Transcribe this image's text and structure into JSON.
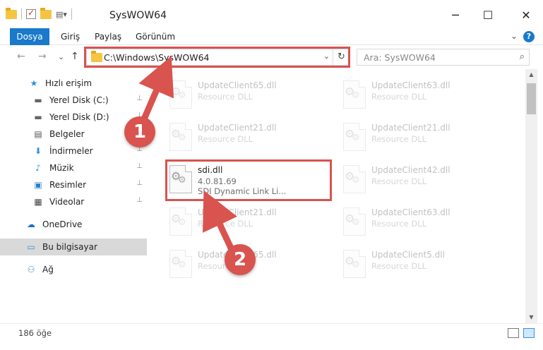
{
  "window": {
    "title": "SysWOW64",
    "minimize": "─",
    "maximize": "☐",
    "close": "✕"
  },
  "ribbon": {
    "tabs": [
      "Dosya",
      "Giriş",
      "Paylaş",
      "Görünüm"
    ],
    "expand": "⌄",
    "help": "?"
  },
  "nav": {
    "back": "←",
    "forward": "→",
    "recent": "⌄",
    "up": "↑",
    "address": "C:\\Windows\\SysWOW64",
    "address_dropdown": "⌄",
    "refresh": "↻",
    "search_placeholder": "Ara: SysWOW64",
    "search_icon": "⌕"
  },
  "sidebar": {
    "items": [
      {
        "label": "Hızlı erişim",
        "icon": "star-icon",
        "glyph": "★",
        "color": "#2f8fdc",
        "pinned": false
      },
      {
        "label": "Yerel Disk (C:)",
        "icon": "drive-icon",
        "glyph": "▬",
        "color": "#666",
        "pinned": true
      },
      {
        "label": "Yerel Disk (D:)",
        "icon": "drive-icon",
        "glyph": "▬",
        "color": "#666",
        "pinned": true
      },
      {
        "label": "Belgeler",
        "icon": "documents-icon",
        "glyph": "▤",
        "color": "#555",
        "pinned": true
      },
      {
        "label": "İndirmeler",
        "icon": "download-icon",
        "glyph": "⬇",
        "color": "#2f8fdc",
        "pinned": true
      },
      {
        "label": "Müzik",
        "icon": "music-icon",
        "glyph": "♪",
        "color": "#2f8fdc",
        "pinned": true
      },
      {
        "label": "Resimler",
        "icon": "pictures-icon",
        "glyph": "▣",
        "color": "#2f7fbf",
        "pinned": true
      },
      {
        "label": "Videolar",
        "icon": "video-icon",
        "glyph": "▦",
        "color": "#444",
        "pinned": true
      },
      {
        "label": "OneDrive",
        "icon": "cloud-icon",
        "glyph": "☁",
        "color": "#1f6fc6",
        "pinned": false
      },
      {
        "label": "Bu bilgisayar",
        "icon": "computer-icon",
        "glyph": "▭",
        "color": "#2f8fdc",
        "pinned": false
      },
      {
        "label": "Ağ",
        "icon": "network-icon",
        "glyph": "⚇",
        "color": "#2f8fdc",
        "pinned": false
      }
    ],
    "pin_glyph": "📌"
  },
  "files": [
    {
      "name": "UpdateClient65.dll",
      "type": "Resource DLL",
      "version": ""
    },
    {
      "name": "UpdateClient63.dll",
      "type": "Resource DLL",
      "version": ""
    },
    {
      "name": "UpdateClient21.dll",
      "type": "Resource DLL",
      "version": ""
    },
    {
      "name": "UpdateClient21.dll",
      "type": "Resource DLL",
      "version": ""
    },
    {
      "name": "sdi.dll",
      "version": "4.0.81.69",
      "type": "SDI Dynamic Link Li..."
    },
    {
      "name": "UpdateClient42.dll",
      "type": "Resource DLL",
      "version": ""
    },
    {
      "name": "UpdateClient21.dll",
      "type": "Resource DLL",
      "version": ""
    },
    {
      "name": "UpdateClient63.dll",
      "type": "Resource DLL",
      "version": ""
    },
    {
      "name": "UpdateClient65.dll",
      "type": "Resource DLL",
      "version": ""
    },
    {
      "name": "UpdateClient5.dll",
      "type": "Resource DLL",
      "version": ""
    }
  ],
  "status": {
    "count": "186 öğe"
  },
  "annotations": {
    "step1": "1",
    "step2": "2",
    "color": "#d9534f"
  }
}
